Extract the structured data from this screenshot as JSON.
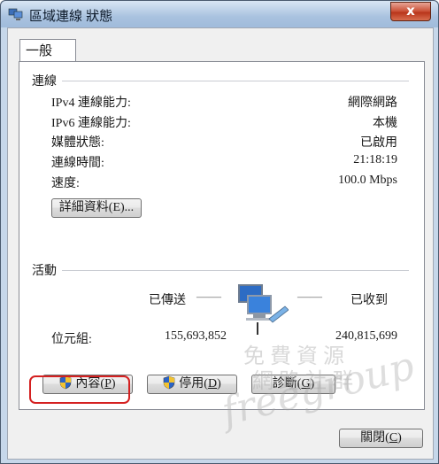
{
  "window": {
    "title": "區域連線 狀態",
    "close_glyph": "x"
  },
  "tab": {
    "label": "一般"
  },
  "connection": {
    "heading": "連線",
    "rows": [
      {
        "label": "IPv4 連線能力:",
        "value": "網際網路"
      },
      {
        "label": "IPv6 連線能力:",
        "value": "本機"
      },
      {
        "label": "媒體狀態:",
        "value": "已啟用"
      },
      {
        "label": "連線時間:",
        "value": "21:18:19"
      },
      {
        "label": "速度:",
        "value": "100.0 Mbps"
      }
    ],
    "details_button": "詳細資料(E)..."
  },
  "activity": {
    "heading": "活動",
    "sent_label": "已傳送",
    "received_label": "已收到",
    "dash": "——",
    "bytes_label": "位元組:",
    "bytes_sent": "155,693,852",
    "bytes_received": "240,815,699"
  },
  "buttons": {
    "properties": {
      "text": "內容",
      "accel": "P"
    },
    "disable": {
      "text": "停用",
      "accel": "D"
    },
    "diagnose": {
      "text": "診斷",
      "accel": "G"
    },
    "close": {
      "text": "關閉",
      "accel": "C"
    }
  },
  "watermark": {
    "line1": "免費資源",
    "line2": "網路社群",
    "line3": "freegroup"
  },
  "colors": {
    "highlight": "#d42020",
    "shield_blue": "#2a63c7",
    "shield_yellow": "#f2c230"
  }
}
